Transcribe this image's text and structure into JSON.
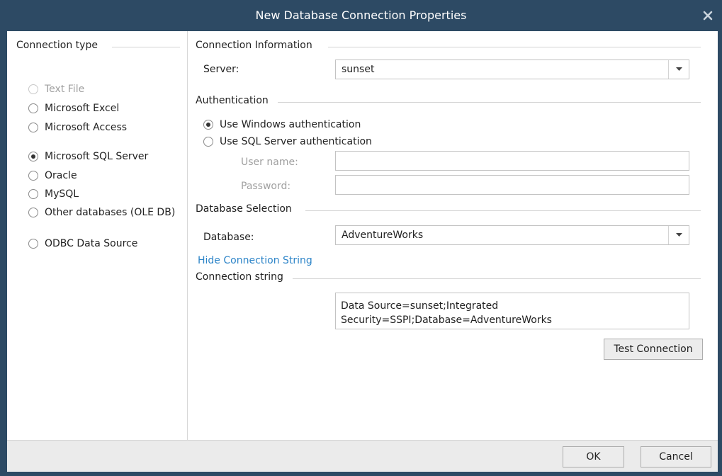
{
  "window": {
    "title": "New Database Connection Properties",
    "close_icon": "close-icon"
  },
  "connection_type": {
    "heading": "Connection type",
    "options": [
      {
        "label": "Text File",
        "selected": false,
        "disabled": true
      },
      {
        "label": "Microsoft Excel",
        "selected": false,
        "disabled": false
      },
      {
        "label": "Microsoft Access",
        "selected": false,
        "disabled": false
      },
      {
        "label": "Microsoft SQL Server",
        "selected": true,
        "disabled": false
      },
      {
        "label": "Oracle",
        "selected": false,
        "disabled": false
      },
      {
        "label": "MySQL",
        "selected": false,
        "disabled": false
      },
      {
        "label": "Other databases (OLE DB)",
        "selected": false,
        "disabled": false
      },
      {
        "label": "ODBC Data Source",
        "selected": false,
        "disabled": false
      }
    ]
  },
  "connection_info": {
    "heading": "Connection Information",
    "server_label": "Server:",
    "server_value": "sunset"
  },
  "authentication": {
    "heading": "Authentication",
    "windows_label": "Use Windows authentication",
    "sql_label": "Use SQL Server authentication",
    "selected": "windows",
    "username_label": "User name:",
    "username_value": "",
    "password_label": "Password:",
    "password_value": ""
  },
  "database_selection": {
    "heading": "Database Selection",
    "database_label": "Database:",
    "database_value": "AdventureWorks"
  },
  "connection_string": {
    "toggle_link": "Hide Connection String",
    "heading": "Connection string",
    "value": "Data Source=sunset;Integrated Security=SSPI;Database=AdventureWorks"
  },
  "buttons": {
    "test_connection": "Test Connection",
    "ok": "OK",
    "cancel": "Cancel"
  },
  "colors": {
    "titlebar": "#2d4a64",
    "link": "#2c84c8",
    "footer": "#ebebeb"
  }
}
